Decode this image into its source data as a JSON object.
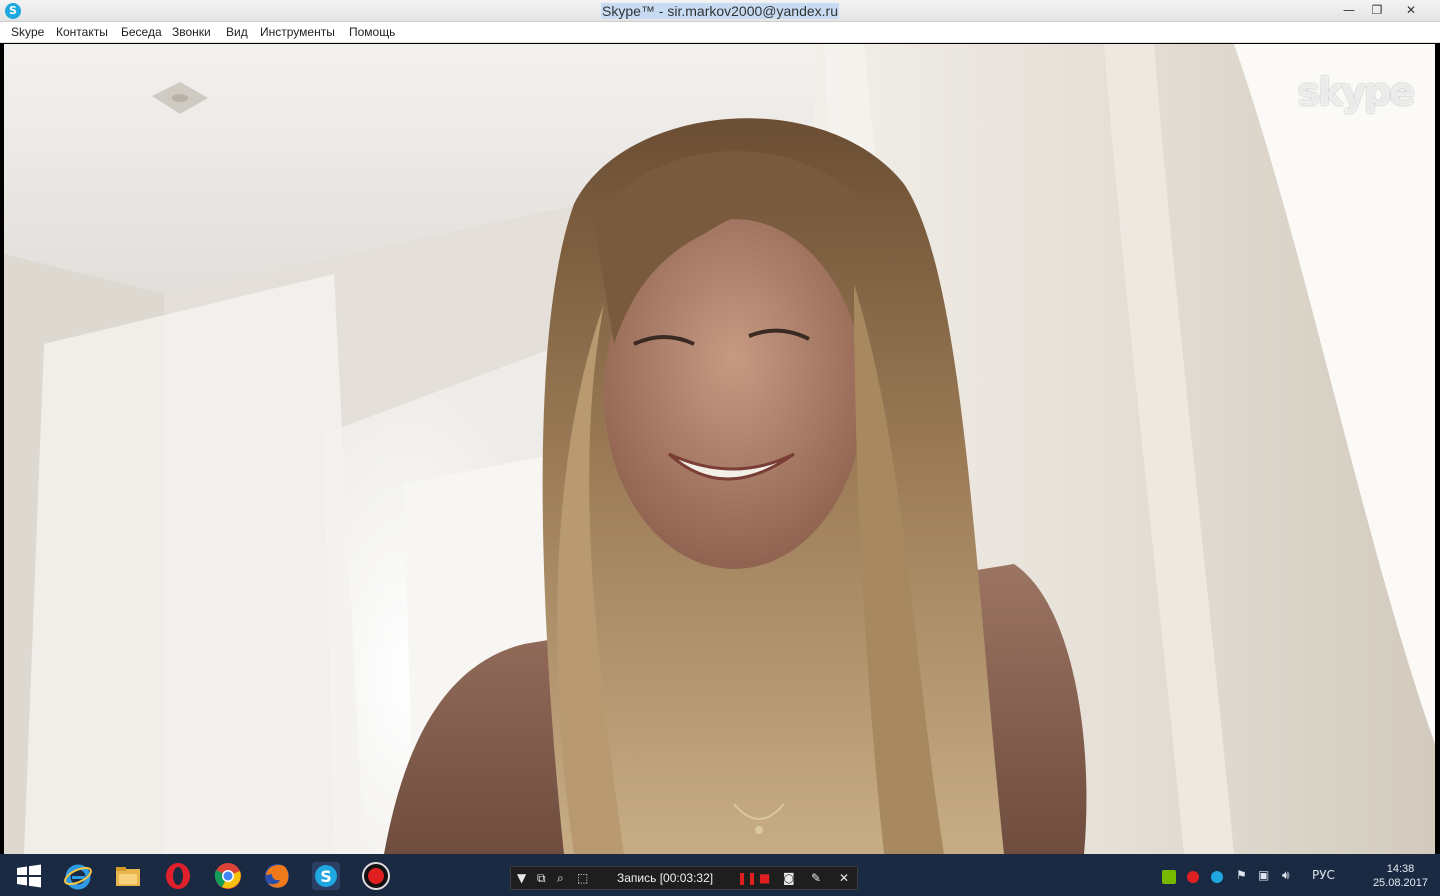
{
  "window": {
    "title": "Skype™ - sir.markov2000@yandex.ru",
    "app_icon_letter": "S",
    "minimize": "—",
    "restore": "❐",
    "close": "✕"
  },
  "menu": {
    "items": [
      "Skype",
      "Контакты",
      "Беседа",
      "Звонки",
      "Вид",
      "Инструменты",
      "Помощь"
    ]
  },
  "video": {
    "watermark": "skype"
  },
  "recorder": {
    "label": "Запись [00:03:32]"
  },
  "tray": {
    "language": "РУС",
    "time": "14:38",
    "date": "25.08.2017"
  },
  "colors": {
    "taskbar": "#1b2a43",
    "skype_blue": "#1ea7e1",
    "record_red": "#e02020"
  },
  "icons": {
    "taskbar": [
      "windows-start-icon",
      "internet-explorer-icon",
      "file-explorer-icon",
      "opera-icon",
      "chrome-icon",
      "firefox-icon",
      "skype-icon",
      "record-icon"
    ]
  }
}
